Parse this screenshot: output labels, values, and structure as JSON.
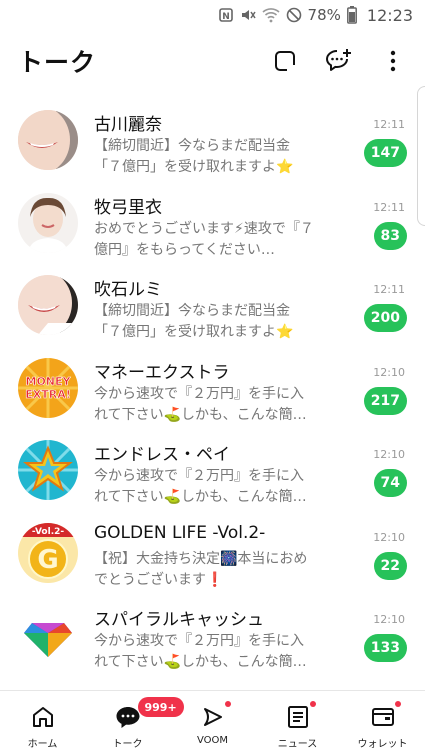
{
  "status_bar": {
    "battery_percent": "78%",
    "time": "12:23"
  },
  "header": {
    "title": "トーク"
  },
  "chats": [
    {
      "name": "古川麗奈",
      "preview": "【締切間近】今ならまだ配当金「７億円」を受け取れますよ⭐",
      "time": "12:11",
      "unread": "147",
      "avatar": "woman-smile-avatar"
    },
    {
      "name": "牧弓里衣",
      "preview": "おめでとうございます⚡速攻で『７億円』をもらってください…",
      "time": "12:11",
      "unread": "83",
      "avatar": "woman-portrait-avatar"
    },
    {
      "name": "吹石ルミ",
      "preview": "【締切間近】今ならまだ配当金「７億円」を受け取れますよ⭐",
      "time": "12:11",
      "unread": "200",
      "avatar": "woman-smile-avatar"
    },
    {
      "name": "マネーエクストラ",
      "preview": "今から速攻で『２万円』を手に入れて下さい⛳しかも、こんな簡…",
      "time": "12:10",
      "unread": "217",
      "avatar": "money-extra-logo",
      "logo_text": "MONEY EXTRA"
    },
    {
      "name": "エンドレス・ペイ",
      "preview": "今から速攻で『２万円』を手に入れて下さい⛳しかも、こんな簡…",
      "time": "12:10",
      "unread": "74",
      "avatar": "star-burst-logo"
    },
    {
      "name": "GOLDEN LIFE -Vol.2-",
      "preview": "【祝】大金持ち決定🎆本当におめでとうございます❗",
      "time": "12:10",
      "unread": "22",
      "avatar": "golden-life-logo",
      "logo_text": "-Vol.2-"
    },
    {
      "name": "スパイラルキャッシュ",
      "preview": "今から速攻で『２万円』を手に入れて下さい⛳しかも、こんな簡…",
      "time": "12:10",
      "unread": "133",
      "avatar": "diamond-logo"
    }
  ],
  "bottom_nav": {
    "items": [
      {
        "label": "ホーム",
        "icon": "home-icon"
      },
      {
        "label": "トーク",
        "icon": "chat-bubble-icon",
        "badge": "999+"
      },
      {
        "label": "VOOM",
        "icon": "voom-icon"
      },
      {
        "label": "ニュース",
        "icon": "news-icon"
      },
      {
        "label": "ウォレット",
        "icon": "wallet-icon"
      }
    ]
  },
  "colors": {
    "badge_green": "#27c25a",
    "notify_red": "#f0324a"
  }
}
